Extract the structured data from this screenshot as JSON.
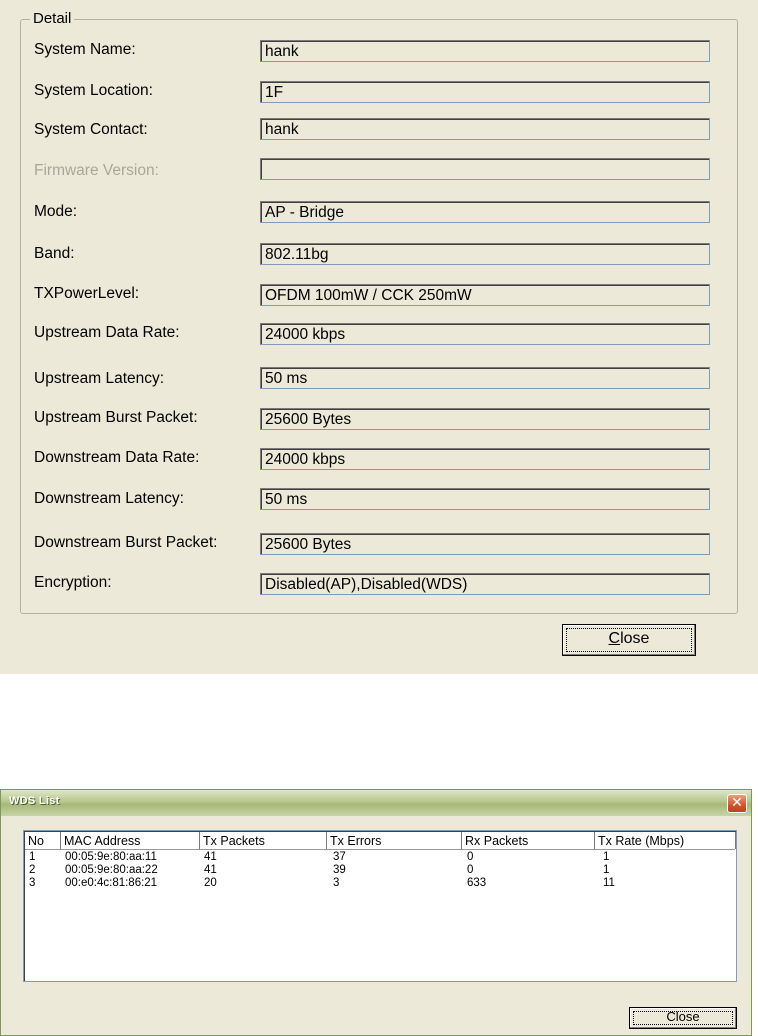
{
  "detail": {
    "group_title": "Detail",
    "fields": [
      {
        "label": "System Name:",
        "value": "hank",
        "disabled": false
      },
      {
        "label": "System Location:",
        "value": "1F",
        "disabled": false
      },
      {
        "label": "System Contact:",
        "value": "hank",
        "disabled": false
      },
      {
        "label": "Firmware Version:",
        "value": "",
        "disabled": true
      },
      {
        "label": "Mode:",
        "value": "AP - Bridge",
        "disabled": false
      },
      {
        "label": "Band:",
        "value": "802.11bg",
        "disabled": false
      },
      {
        "label": "TXPowerLevel:",
        "value": "OFDM 100mW / CCK 250mW",
        "disabled": false
      },
      {
        "label": "Upstream Data Rate:",
        "value": "24000 kbps",
        "disabled": false
      },
      {
        "label": "Upstream Latency:",
        "value": "50 ms",
        "disabled": false
      },
      {
        "label": "Upstream Burst Packet:",
        "value": "25600 Bytes",
        "disabled": false
      },
      {
        "label": "Downstream Data Rate:",
        "value": "24000 kbps",
        "disabled": false
      },
      {
        "label": "Downstream Latency:",
        "value": "50 ms",
        "disabled": false
      },
      {
        "label": "Downstream Burst Packet:",
        "value": "25600 Bytes",
        "disabled": false
      },
      {
        "label": "Encryption:",
        "value": "Disabled(AP),Disabled(WDS)",
        "disabled": false
      }
    ],
    "close_label": "Close"
  },
  "wds": {
    "title": "WDS List",
    "close_x_icon": "close-icon",
    "columns": [
      "No",
      "MAC Address",
      "Tx Packets",
      "Tx Errors",
      "Rx Packets",
      "Tx Rate (Mbps)"
    ],
    "rows": [
      [
        "1",
        "00:05:9e:80:aa:11",
        "41",
        "37",
        "0",
        "1"
      ],
      [
        "2",
        "00:05:9e:80:aa:22",
        "41",
        "39",
        "0",
        "1"
      ],
      [
        "3",
        "00:e0:4c:81:86:21",
        "20",
        "3",
        "633",
        "11"
      ]
    ],
    "close_label": "Close"
  }
}
